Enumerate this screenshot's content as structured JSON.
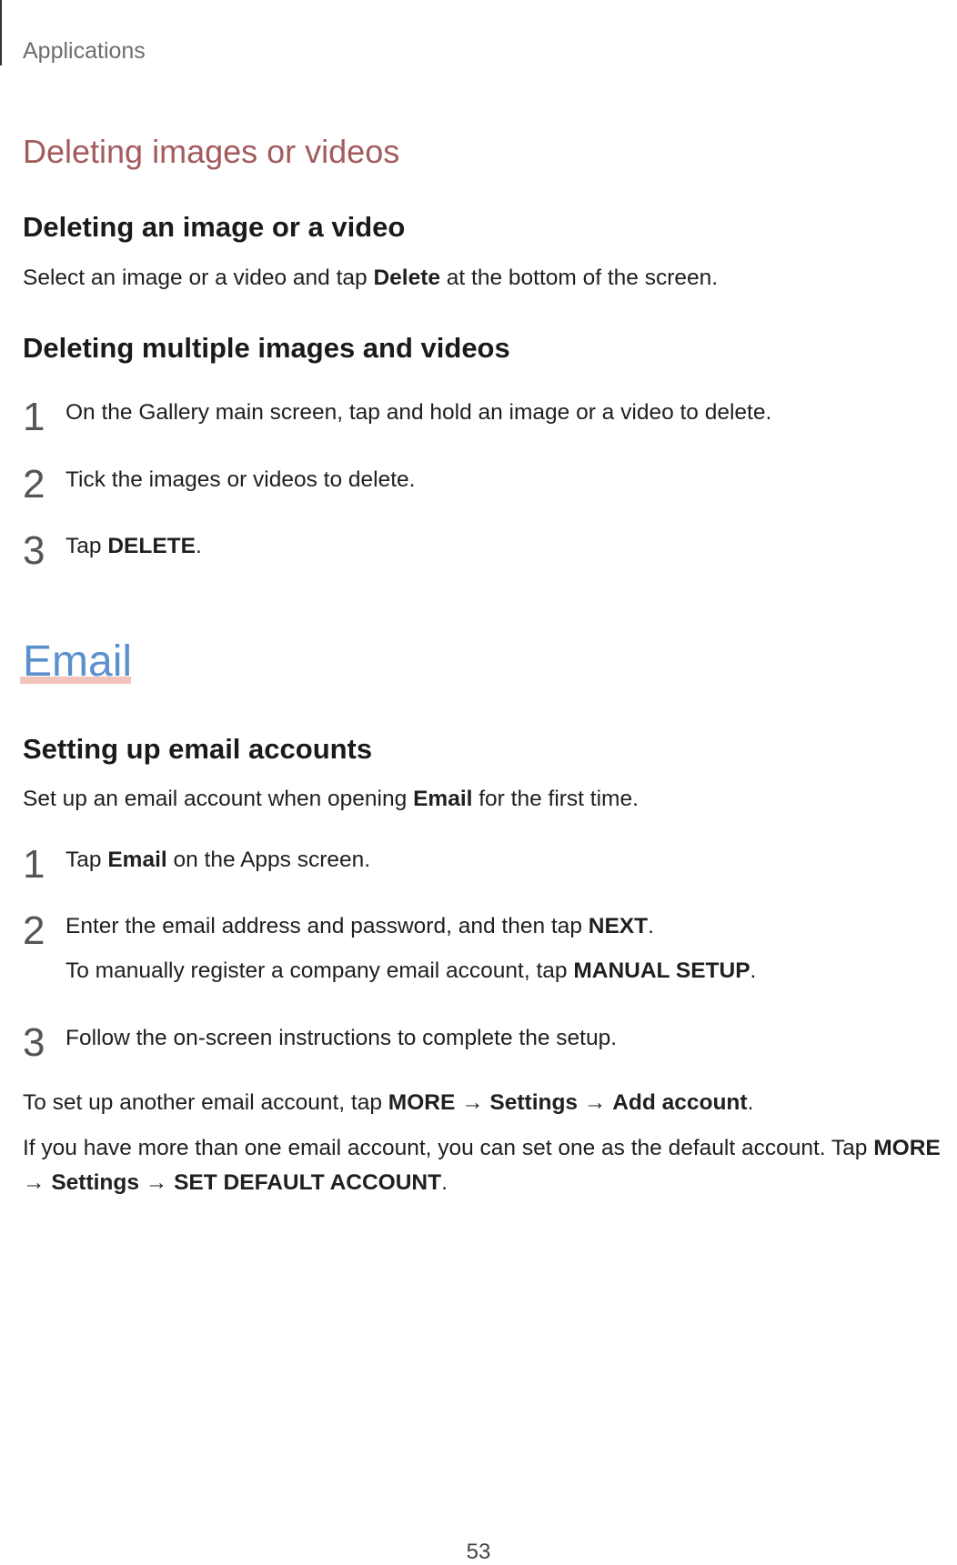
{
  "header": {
    "section": "Applications"
  },
  "deleting": {
    "title": "Deleting images or videos",
    "single": {
      "heading": "Deleting an image or a video",
      "text_before": "Select an image or a video and tap ",
      "bold": "Delete",
      "text_after": " at the bottom of the screen."
    },
    "multiple": {
      "heading": "Deleting multiple images and videos",
      "steps": [
        {
          "num": "1",
          "text": "On the Gallery main screen, tap and hold an image or a video to delete."
        },
        {
          "num": "2",
          "text": "Tick the images or videos to delete."
        },
        {
          "num": "3",
          "pre": "Tap ",
          "bold": "DELETE",
          "post": "."
        }
      ]
    }
  },
  "email": {
    "title": "Email",
    "setup": {
      "heading": "Setting up email accounts",
      "intro_before": "Set up an email account when opening ",
      "intro_bold": "Email",
      "intro_after": " for the first time.",
      "steps": [
        {
          "num": "1",
          "pre": "Tap ",
          "bold": "Email",
          "post": " on the Apps screen."
        },
        {
          "num": "2",
          "pre": "Enter the email address and password, and then tap ",
          "bold": "NEXT",
          "post": ".",
          "sub_pre": "To manually register a company email account, tap ",
          "sub_bold": "MANUAL SETUP",
          "sub_post": "."
        },
        {
          "num": "3",
          "text": "Follow the on-screen instructions to complete the setup."
        }
      ]
    },
    "another": {
      "pre": "To set up another email account, tap ",
      "b1": "MORE",
      "arrow1": " → ",
      "b2": "Settings",
      "arrow2": " → ",
      "b3": "Add account",
      "post": "."
    },
    "default": {
      "line1_pre": "If you have more than one email account, you can set one as the default account. Tap ",
      "line1_bold": "MORE",
      "line2_arrow1": "→ ",
      "line2_b1": "Settings",
      "line2_arrow2": " → ",
      "line2_b2": "SET DEFAULT ACCOUNT",
      "line2_post": "."
    }
  },
  "footer": {
    "page_number": "53"
  }
}
